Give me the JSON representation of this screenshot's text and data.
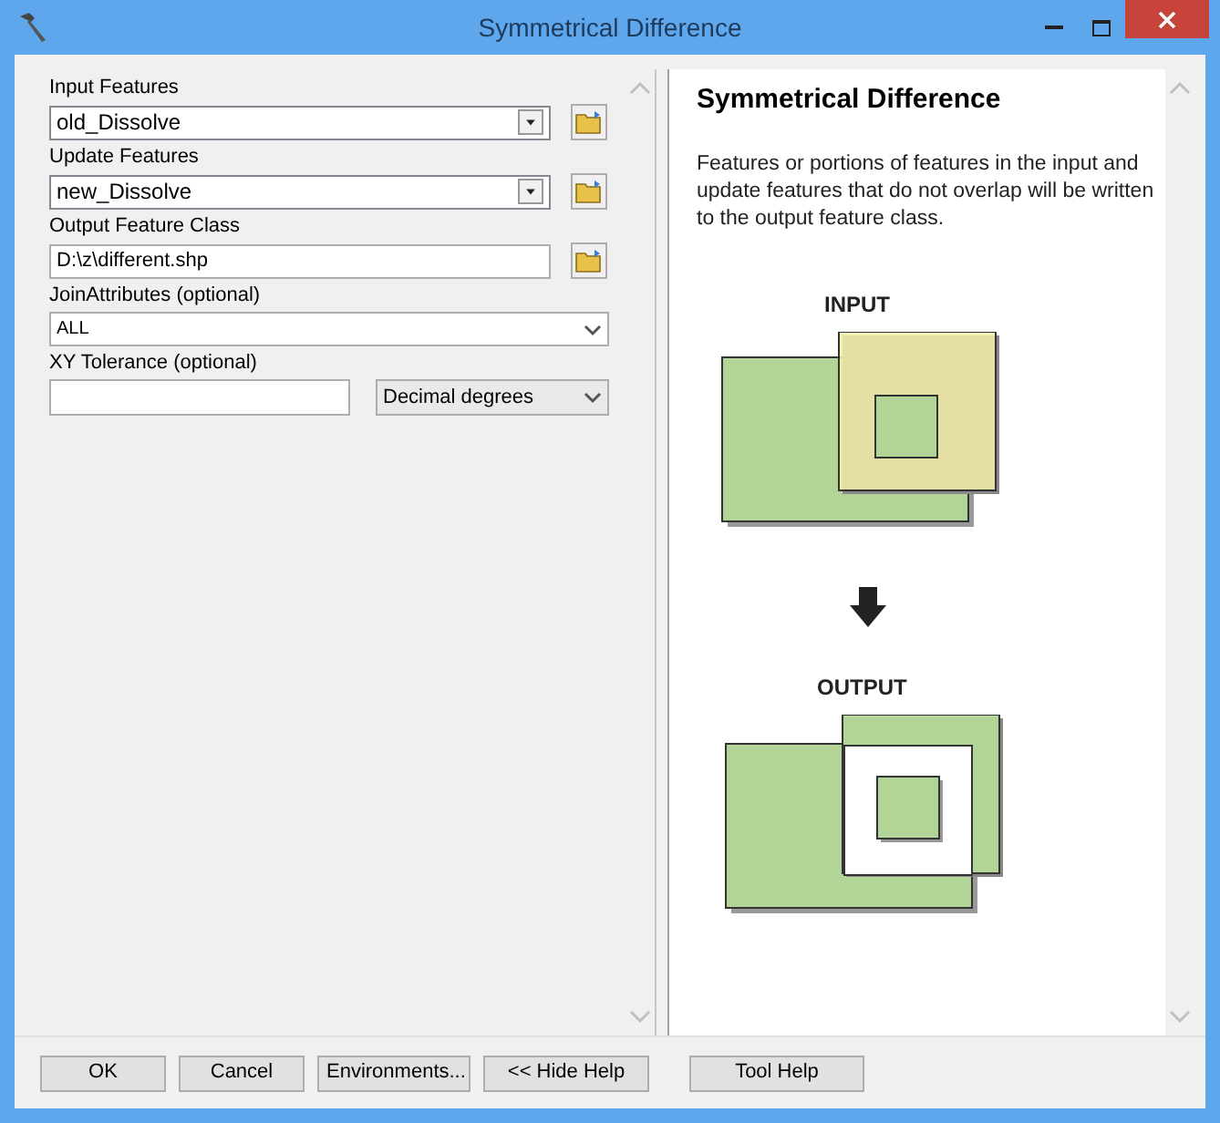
{
  "window": {
    "title": "Symmetrical Difference"
  },
  "parameters": [
    {
      "kind": "combo",
      "label": "Input Features",
      "value": "old_Dissolve"
    },
    {
      "kind": "combo",
      "label": "Update Features",
      "value": "new_Dissolve"
    },
    {
      "kind": "text",
      "label": "Output Feature Class",
      "value": "D:\\z\\different.shp"
    },
    {
      "kind": "select",
      "label": "JoinAttributes (optional)",
      "value": "ALL"
    },
    {
      "kind": "tolerance",
      "label": "XY Tolerance (optional)",
      "unit": "Decimal degrees"
    }
  ],
  "help": {
    "title": "Symmetrical Difference",
    "text": "Features or portions of features in the input and update features that do not overlap will be written to the output feature class.",
    "input_label": "INPUT",
    "output_label": "OUTPUT"
  },
  "buttons": [
    {
      "label": "OK"
    },
    {
      "label": "Cancel"
    },
    {
      "label": "Environments..."
    },
    {
      "label": "<< Hide Help"
    },
    {
      "label": "Tool Help"
    }
  ]
}
